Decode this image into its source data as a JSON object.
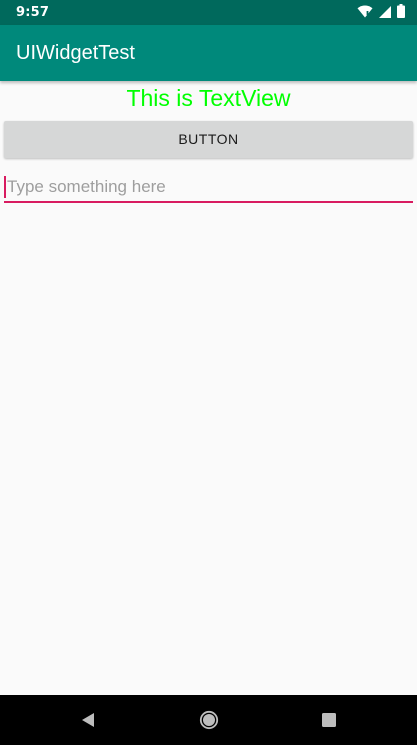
{
  "status_bar": {
    "time": "9:57",
    "icons": [
      "wifi-icon",
      "signal-icon",
      "battery-icon"
    ]
  },
  "app_bar": {
    "title": "UIWidgetTest"
  },
  "main": {
    "textview": "This is TextView",
    "button_label": "BUTTON",
    "edittext": {
      "value": "",
      "placeholder": "Type something here"
    }
  },
  "nav_bar": {
    "icons": [
      "back-icon",
      "home-icon",
      "recents-icon"
    ]
  },
  "colors": {
    "status_bar": "#00695c",
    "app_bar": "#00897b",
    "textview": "#00ff00",
    "accent": "#d81b60",
    "button_bg": "#d6d7d7"
  }
}
